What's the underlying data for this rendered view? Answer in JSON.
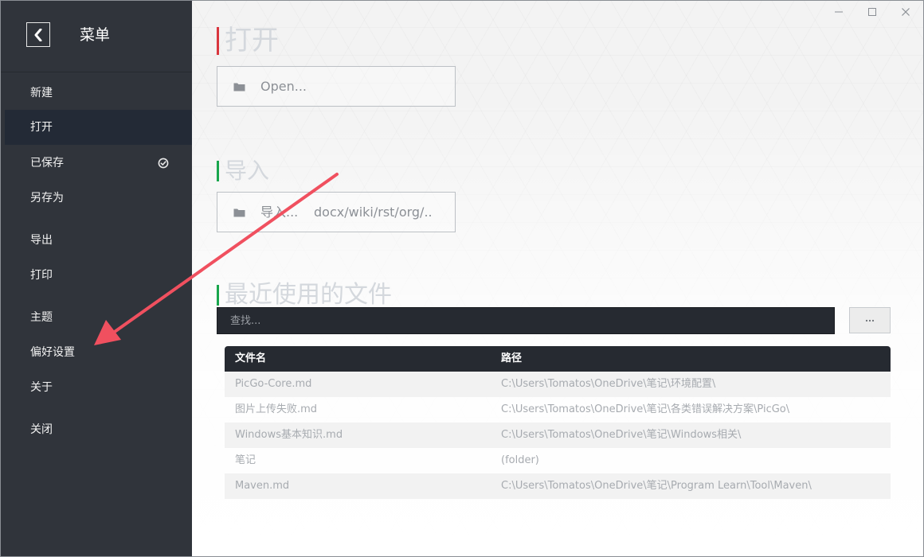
{
  "sidebar": {
    "back_glyph": "❮",
    "title": "菜单",
    "items": [
      {
        "label": "新建"
      },
      {
        "label": "打开",
        "active": true
      },
      {
        "label": "已保存",
        "icon": "check-circle-icon"
      },
      {
        "label": "另存为"
      },
      {
        "label": "导出"
      },
      {
        "label": "打印"
      },
      {
        "label": "主题"
      },
      {
        "label": "偏好设置"
      },
      {
        "label": "关于"
      },
      {
        "label": "关闭"
      }
    ]
  },
  "window_controls": {
    "minimize": "minimize-icon",
    "maximize": "maximize-icon",
    "close": "close-icon"
  },
  "open_section": {
    "title": "打开",
    "accent_color": "#d9363e",
    "box_label": "Open..."
  },
  "import_section": {
    "title": "导入",
    "accent_color": "#19a64d",
    "box_label": "导入...",
    "box_formats": "docx/wiki/rst/org/.."
  },
  "recent_section": {
    "title": "最近使用的文件",
    "accent_color": "#19a64d",
    "search_placeholder": "查找...",
    "more_button": "···",
    "columns": [
      "文件名",
      "路径"
    ],
    "rows": [
      {
        "name": "PicGo-Core.md",
        "path": "C:\\Users\\Tomatos\\OneDrive\\笔记\\环境配置\\"
      },
      {
        "name": "图片上传失败.md",
        "path": "C:\\Users\\Tomatos\\OneDrive\\笔记\\各类错误解决方案\\PicGo\\"
      },
      {
        "name": "Windows基本知识.md",
        "path": "C:\\Users\\Tomatos\\OneDrive\\笔记\\Windows相关\\"
      },
      {
        "name": "笔记",
        "path": "(folder)"
      },
      {
        "name": "Maven.md",
        "path": "C:\\Users\\Tomatos\\OneDrive\\笔记\\Program Learn\\Tool\\Maven\\"
      }
    ]
  },
  "annotation": {
    "type": "arrow",
    "color": "#f0505f",
    "points_to": "偏好设置"
  }
}
